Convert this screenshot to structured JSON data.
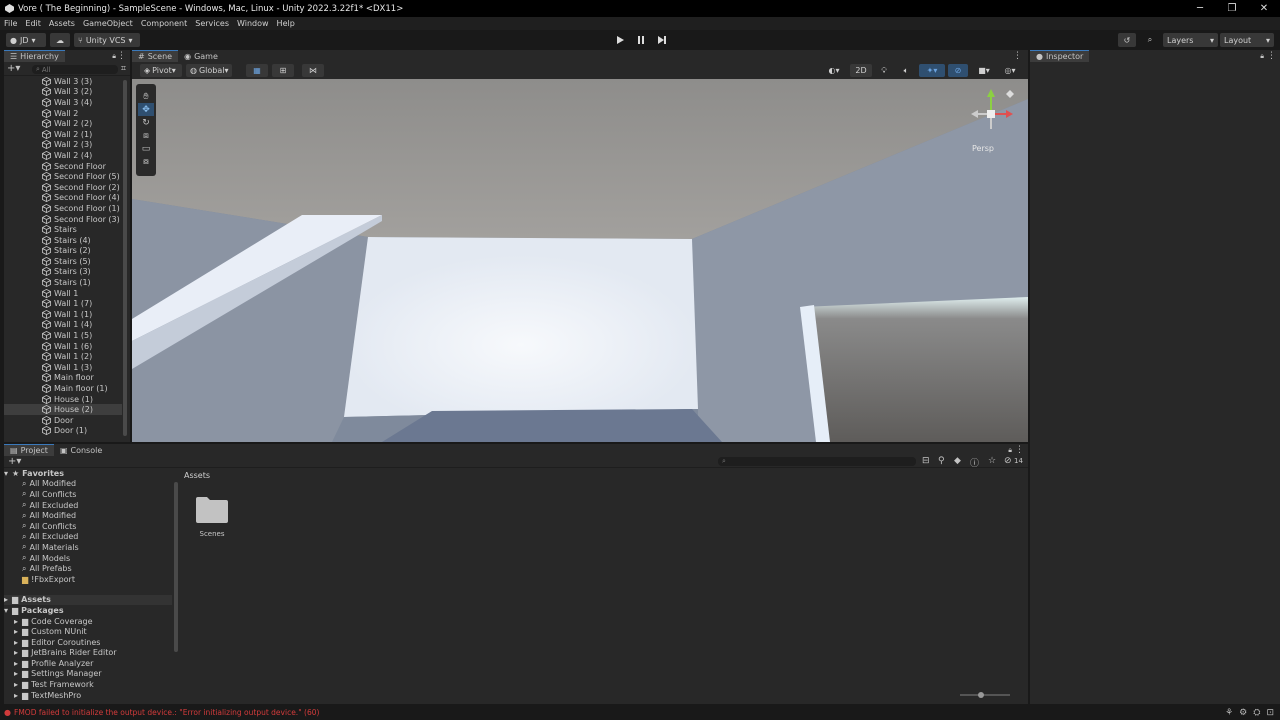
{
  "window": {
    "title": "Vore ( The Beginning) - SampleScene - Windows, Mac, Linux - Unity 2022.3.22f1* <DX11>",
    "controls": [
      "─",
      "❐",
      "✕"
    ]
  },
  "menu": [
    "File",
    "Edit",
    "Assets",
    "GameObject",
    "Component",
    "Services",
    "Window",
    "Help"
  ],
  "toolbar": {
    "account": "JD",
    "vcs": "Unity VCS",
    "layers": "Layers",
    "layout": "Layout"
  },
  "hierarchy": {
    "tab": "Hierarchy",
    "search_placeholder": "All",
    "items": [
      "Wall 3 (3)",
      "Wall 3 (2)",
      "Wall 3 (4)",
      "Wall 2",
      "Wall 2 (2)",
      "Wall 2 (1)",
      "Wall 2 (3)",
      "Wall 2 (4)",
      "Second Floor",
      "Second Floor (5)",
      "Second Floor (2)",
      "Second Floor (4)",
      "Second Floor (1)",
      "Second Floor (3)",
      "Stairs",
      "Stairs (4)",
      "Stairs (2)",
      "Stairs (5)",
      "Stairs (3)",
      "Stairs (1)",
      "Wall 1",
      "Wall 1 (7)",
      "Wall 1 (1)",
      "Wall 1 (4)",
      "Wall 1 (5)",
      "Wall 1 (6)",
      "Wall 1 (2)",
      "Wall 1 (3)",
      "Main floor",
      "Main floor (1)",
      "House (1)",
      "House (2)",
      "Door",
      "Door (1)"
    ]
  },
  "scene": {
    "tabs": [
      "Scene",
      "Game"
    ],
    "pivot": "Pivot",
    "global": "Global",
    "mode_2d": "2D",
    "gizmo_label": "Persp"
  },
  "inspector": {
    "tab": "Inspector"
  },
  "project": {
    "tabs": [
      "Project",
      "Console"
    ],
    "favorites_label": "Favorites",
    "favorites": [
      "All Modified",
      "All Conflicts",
      "All Excluded",
      "All Modified",
      "All Conflicts",
      "All Excluded",
      "All Materials",
      "All Models",
      "All Prefabs",
      "!FbxExport"
    ],
    "assets_label": "Assets",
    "packages_label": "Packages",
    "packages": [
      "Code Coverage",
      "Custom NUnit",
      "Editor Coroutines",
      "JetBrains Rider Editor",
      "Profile Analyzer",
      "Settings Manager",
      "Test Framework",
      "TextMeshPro"
    ],
    "breadcrumb": "Assets",
    "folder_name": "Scenes",
    "count": "14"
  },
  "status": {
    "error": "FMOD failed to initialize the output device.: \"Error initializing output device.\" (60)"
  },
  "colors": {
    "accent": "#3a79bb",
    "error": "#d23b3b"
  }
}
